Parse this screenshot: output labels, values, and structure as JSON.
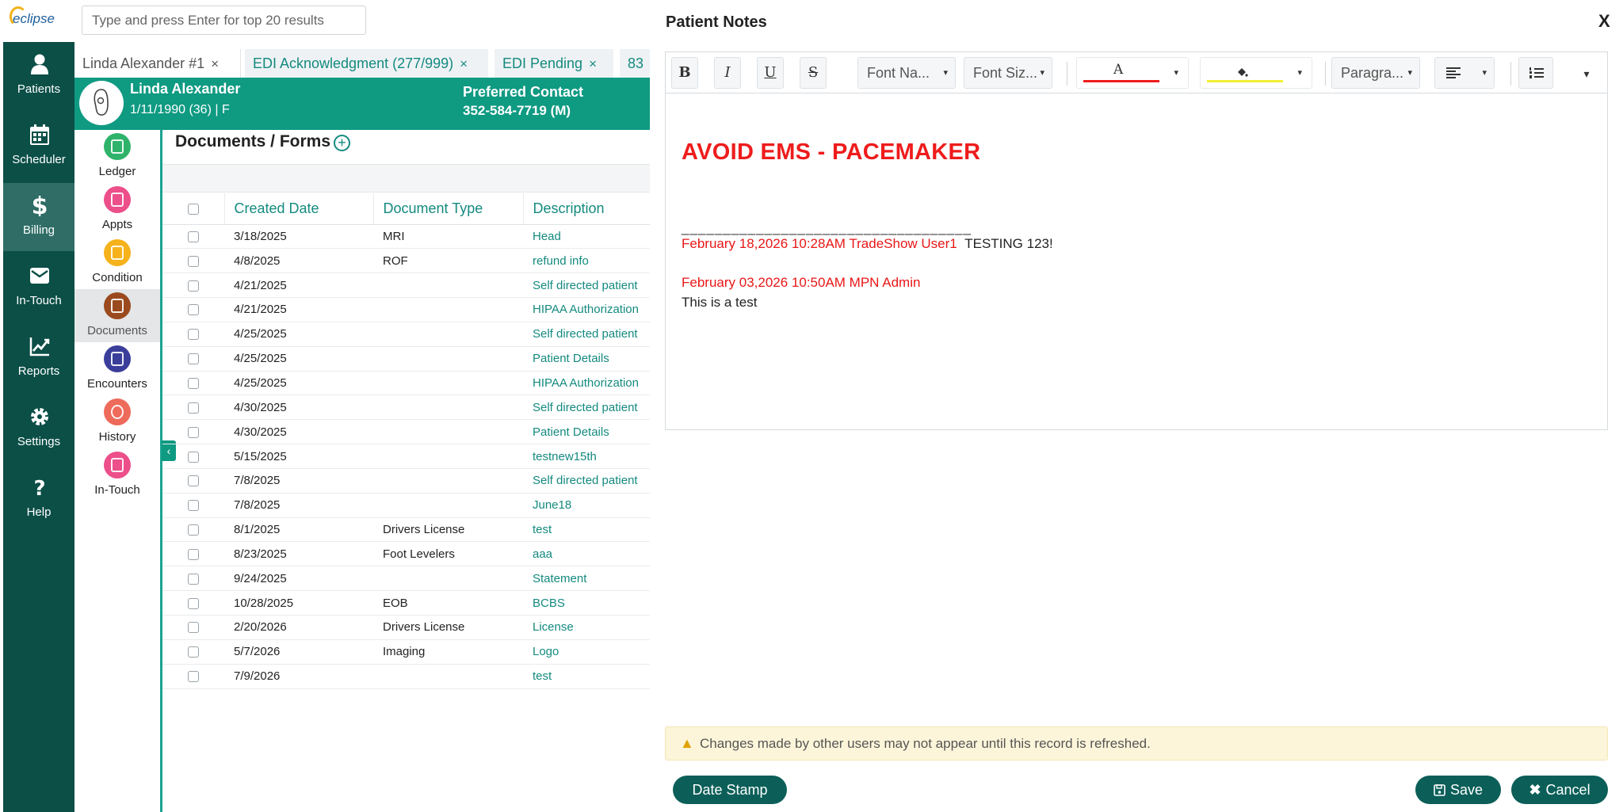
{
  "app": {
    "logo_text": "eclipse"
  },
  "search": {
    "placeholder": "Type and press Enter for top 20 results"
  },
  "rail": {
    "items": [
      {
        "label": "Patients",
        "icon": "person-icon"
      },
      {
        "label": "Scheduler",
        "icon": "calendar-icon"
      },
      {
        "label": "Billing",
        "icon": "dollar-icon"
      },
      {
        "label": "In-Touch",
        "icon": "envelope-icon"
      },
      {
        "label": "Reports",
        "icon": "line-chart-icon"
      },
      {
        "label": "Settings",
        "icon": "gear-icon"
      },
      {
        "label": "Help",
        "icon": "question-icon"
      }
    ],
    "active": "Billing"
  },
  "tabs": [
    {
      "label": "Linda Alexander #1",
      "close": "×"
    },
    {
      "label": "EDI Acknowledgment (277/999)",
      "close": "×"
    },
    {
      "label": "EDI Pending",
      "close": "×"
    },
    {
      "label": "83",
      "close": ""
    }
  ],
  "patient": {
    "name": "Linda Alexander",
    "dob_line": "1/11/1990 (36) | F",
    "preferred_contact_label": "Preferred Contact",
    "preferred_contact_value": "352-584-7719 (M)"
  },
  "subnav": {
    "items": [
      {
        "label": "Ledger",
        "color": "#2fb36b"
      },
      {
        "label": "Appts",
        "color": "#ec4f8a"
      },
      {
        "label": "Condition",
        "color": "#f6b21b"
      },
      {
        "label": "Documents",
        "color": "#9a4a1e"
      },
      {
        "label": "Encounters",
        "color": "#3a3e9a"
      },
      {
        "label": "History",
        "color": "#ee6a5b"
      },
      {
        "label": "In-Touch",
        "color": "#ec4f8a"
      }
    ],
    "active": "Documents"
  },
  "documents": {
    "title": "Documents / Forms",
    "add_label": "+",
    "collapse_label": "‹",
    "columns": [
      "Created Date",
      "Document Type",
      "Description"
    ],
    "rows": [
      {
        "date": "3/18/2025",
        "type": "MRI",
        "desc": "Head"
      },
      {
        "date": "4/8/2025",
        "type": "ROF",
        "desc": "refund info"
      },
      {
        "date": "4/21/2025",
        "type": "",
        "desc": "Self directed patient"
      },
      {
        "date": "4/21/2025",
        "type": "",
        "desc": "HIPAA Authorization"
      },
      {
        "date": "4/25/2025",
        "type": "",
        "desc": "Self directed patient"
      },
      {
        "date": "4/25/2025",
        "type": "",
        "desc": "Patient Details"
      },
      {
        "date": "4/25/2025",
        "type": "",
        "desc": "HIPAA Authorization"
      },
      {
        "date": "4/30/2025",
        "type": "",
        "desc": "Self directed patient"
      },
      {
        "date": "4/30/2025",
        "type": "",
        "desc": "Patient Details"
      },
      {
        "date": "5/15/2025",
        "type": "",
        "desc": "testnew15th"
      },
      {
        "date": "7/8/2025",
        "type": "",
        "desc": "Self directed patient"
      },
      {
        "date": "7/8/2025",
        "type": "",
        "desc": "June18"
      },
      {
        "date": "8/1/2025",
        "type": "Drivers License",
        "desc": "test"
      },
      {
        "date": "8/23/2025",
        "type": "Foot Levelers",
        "desc": "aaa"
      },
      {
        "date": "9/24/2025",
        "type": "",
        "desc": "Statement"
      },
      {
        "date": "10/28/2025",
        "type": "EOB",
        "desc": "BCBS"
      },
      {
        "date": "2/20/2026",
        "type": "Drivers License",
        "desc": "License"
      },
      {
        "date": "5/7/2026",
        "type": "Imaging",
        "desc": "Logo"
      },
      {
        "date": "7/9/2026",
        "type": "",
        "desc": "test"
      }
    ]
  },
  "modal": {
    "title": "Patient Notes",
    "close_label": "X",
    "toolbar": {
      "bold": "B",
      "italic": "I",
      "underline": "U",
      "strike": "S",
      "font_name": "Font Na...",
      "font_size": "Font Siz...",
      "font_color_glyph": "A",
      "font_color": "#ee1c1c",
      "highlight_color": "#f3ef33",
      "paragraph": "Paragra...",
      "caret": "▾"
    },
    "note": {
      "headline": "AVOID EMS - PACEMAKER",
      "separator": "___________________________________",
      "entries": [
        {
          "timestamp": "February 18,2026 10:28AM TradeShow User1",
          "text": "TESTING 123!"
        },
        {
          "timestamp": "February 03,2026 10:50AM MPN Admin",
          "text": "This is a test"
        }
      ]
    },
    "warning": "Changes made by other users may not appear until this record is refreshed.",
    "buttons": {
      "date_stamp": "Date Stamp",
      "save": "Save",
      "cancel": "Cancel"
    }
  },
  "colors": {
    "rail": "#0b4f47",
    "banner": "#0f9a82",
    "accent": "#148a7f",
    "button": "#0b5f58"
  }
}
